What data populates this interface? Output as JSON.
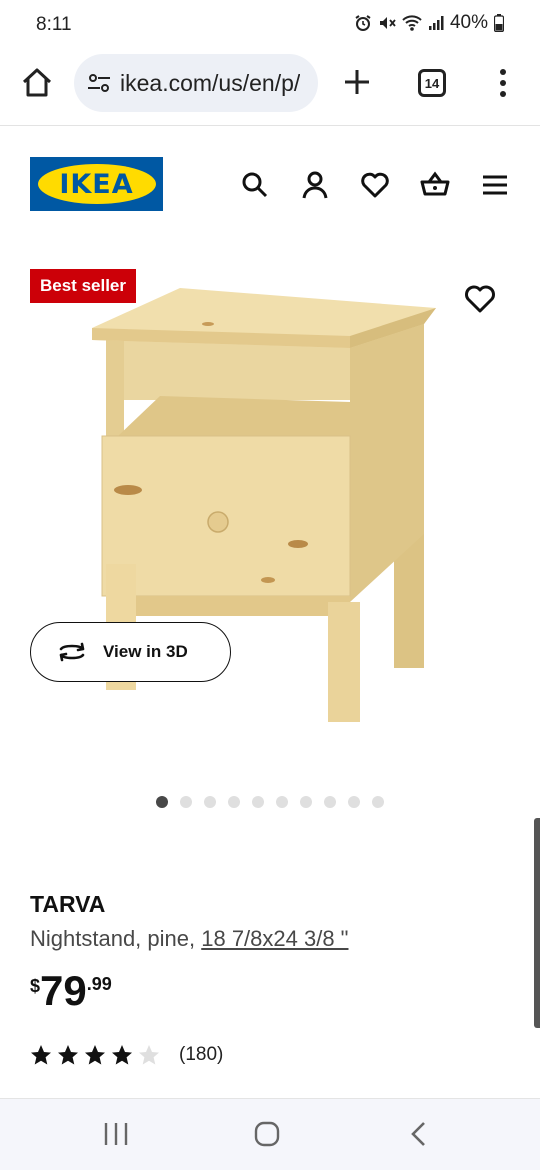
{
  "status_bar": {
    "time": "8:11",
    "battery": "40%"
  },
  "browser": {
    "url": "ikea.com/us/en/p/",
    "tab_count": "14"
  },
  "site": {
    "logo_text": "IKEA",
    "header_icons": [
      "search-icon",
      "account-icon",
      "heart-icon",
      "cart-icon",
      "menu-icon"
    ]
  },
  "product_image": {
    "badge": "Best seller",
    "view_3d_label": "View in 3D",
    "carousel_total": 10,
    "carousel_active": 1
  },
  "product": {
    "name": "TARVA",
    "description": "Nightstand, pine, ",
    "dimensions": "18 7/8x24 3/8 \"",
    "price_currency": "$",
    "price_integer": "79",
    "price_decimal": ".99",
    "rating_stars": 4,
    "rating_max": 5,
    "review_count": "(180)"
  },
  "colors": {
    "ikea_blue": "#0058a3",
    "ikea_yellow": "#ffdb00",
    "badge_red": "#cc0008",
    "pine": "#edd9a5"
  }
}
